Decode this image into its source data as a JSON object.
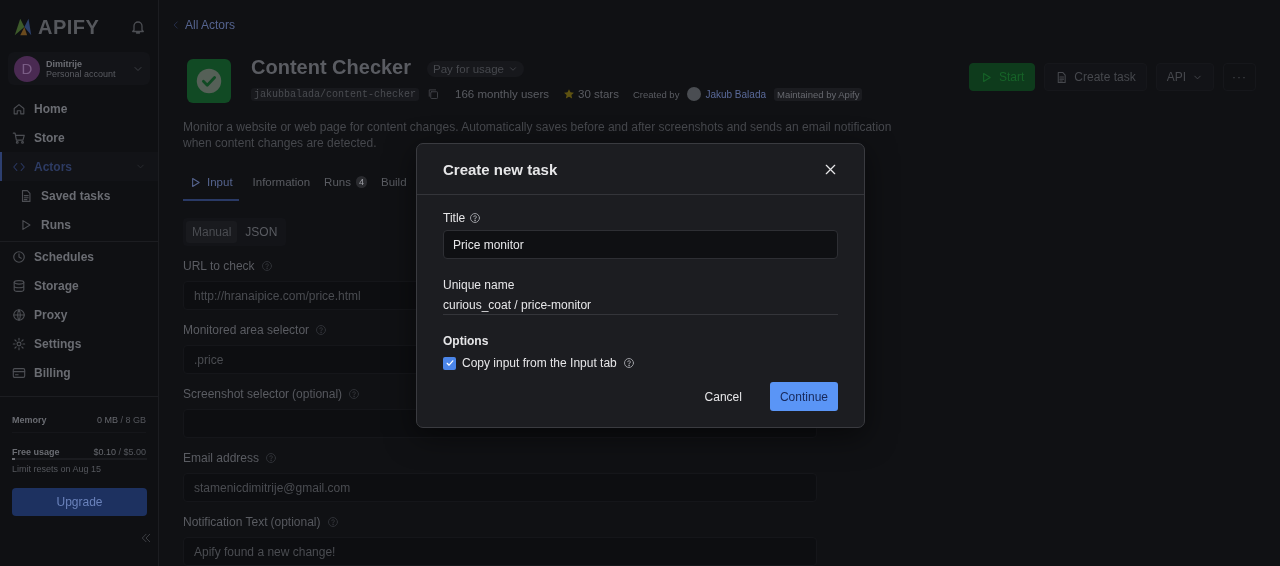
{
  "sidebar": {
    "logo": "APIFY",
    "account": {
      "initial": "D",
      "name": "Dimitrije",
      "subtitle": "Personal account"
    },
    "nav": [
      {
        "label": "Home",
        "selected": false,
        "expanded": false
      },
      {
        "label": "Store",
        "selected": false,
        "expanded": false
      },
      {
        "label": "Actors",
        "selected": true,
        "expanded": true,
        "children": [
          {
            "label": "Saved tasks",
            "selected": false
          },
          {
            "label": "Runs",
            "selected": false
          }
        ]
      },
      {
        "label": "Schedules",
        "selected": false,
        "expanded": false
      },
      {
        "label": "Storage",
        "selected": false,
        "expanded": false
      },
      {
        "label": "Proxy",
        "selected": false,
        "expanded": false
      },
      {
        "label": "Settings",
        "selected": false,
        "expanded": false
      },
      {
        "label": "Billing",
        "selected": false,
        "expanded": false
      }
    ],
    "usage": [
      {
        "label": "Memory",
        "used": "0 MB",
        "limit": "/ 8 GB"
      },
      {
        "label": "Free usage",
        "used": "$0.10",
        "limit": "/ $5.00",
        "level": 0.02
      }
    ],
    "reset_note": "Limit resets on Aug 15",
    "upgrade_button": "Upgrade"
  },
  "breadcrumb": "All Actors",
  "actor": {
    "title": "Content Checker",
    "pricing": "Pay for usage",
    "slug": "jakubbalada/content-checker",
    "users": "166 monthly users",
    "stars": "30 stars",
    "created_by": "Created by",
    "author": "Jakub Balada",
    "maintained": "Maintained by Apify",
    "description": "Monitor a website or web page for content changes. Automatically saves before and after screenshots and sends an email notification when content changes are detected."
  },
  "actions": [
    {
      "label": "Start",
      "kind": "primary"
    },
    {
      "label": "Create task",
      "kind": "secondary"
    },
    {
      "label": "API",
      "kind": "dropdown"
    },
    {
      "label": "···",
      "kind": "more"
    }
  ],
  "tabs": [
    {
      "label": "Input",
      "selected": true
    },
    {
      "label": "Information",
      "selected": false
    },
    {
      "label": "Runs",
      "badge": "4",
      "selected": false
    },
    {
      "label": "Build",
      "selected": false
    }
  ],
  "input_modes": [
    {
      "label": "Manual",
      "selected": true
    },
    {
      "label": "JSON",
      "selected": false
    }
  ],
  "fields": [
    {
      "label": "URL to check",
      "value": "http://hranaipice.com/price.html"
    },
    {
      "label": "Monitored area selector",
      "value": ".price"
    },
    {
      "label": "Screenshot selector",
      "optional": "(optional)"
    },
    {
      "label": "Email address",
      "value": "stamenicdimitrije@gmail.com"
    },
    {
      "label": "Notification Text",
      "optional": "(optional)",
      "value": "Apify found a new change!"
    }
  ],
  "dialog": {
    "title": "Create new task",
    "title_label": "Title",
    "title_value": "Price monitor",
    "unique_label": "Unique name",
    "unique_value": "curious_coat / price-monitor",
    "options_heading": "Options",
    "options": [
      {
        "label": "Copy input from the Input tab",
        "checked": true
      }
    ],
    "buttons": [
      {
        "label": "Cancel",
        "kind": "text"
      },
      {
        "label": "Continue",
        "kind": "primary"
      }
    ]
  }
}
